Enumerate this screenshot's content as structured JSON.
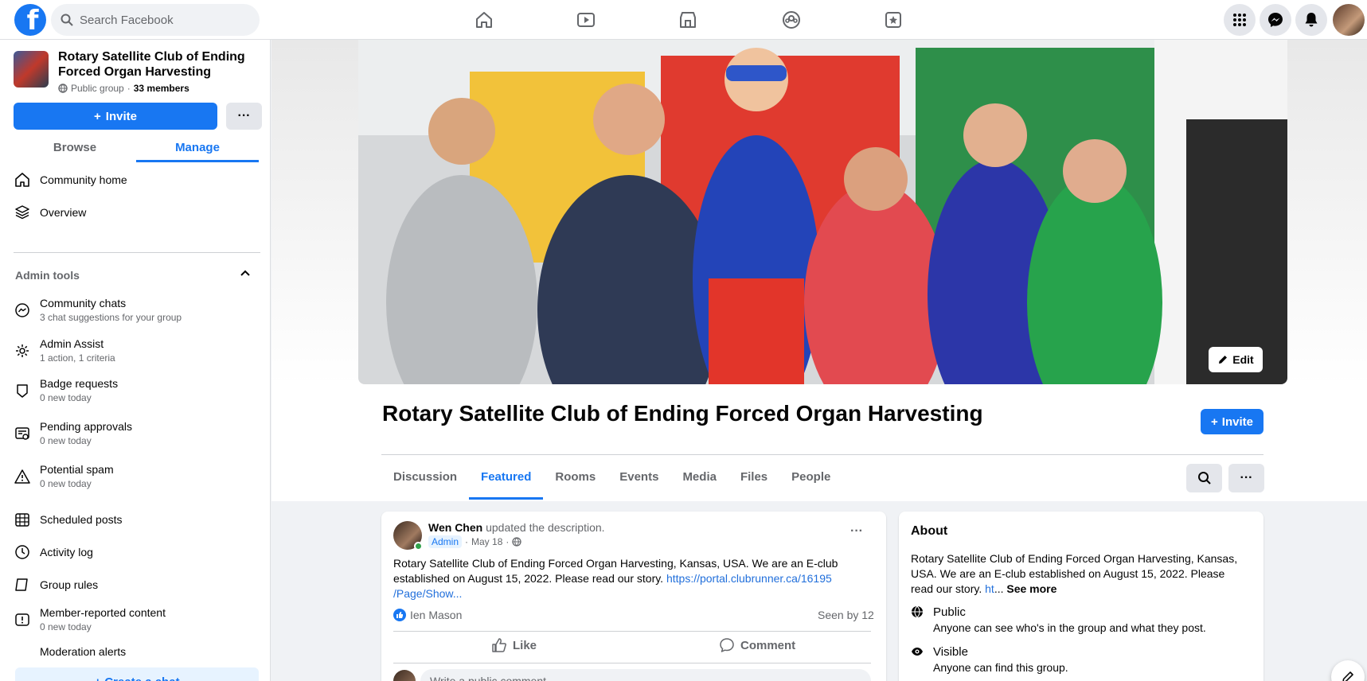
{
  "search": {
    "placeholder": "Search Facebook"
  },
  "nav": {
    "icons": [
      "home-icon",
      "watch-icon",
      "marketplace-icon",
      "groups-icon",
      "gaming-icon"
    ]
  },
  "header_right": {
    "icons": [
      "menu-grid-icon",
      "messenger-icon",
      "notifications-icon",
      "account-avatar"
    ]
  },
  "group": {
    "name": "Rotary Satellite Club of Ending Forced Organ Harvesting",
    "privacy": "Public group",
    "members": "33 members",
    "invite_label": "Invite",
    "more_label": "···"
  },
  "sidebar": {
    "tabs": [
      "Browse",
      "Manage"
    ],
    "active_tab": "Manage",
    "top_items": [
      {
        "label": "Community home",
        "icon": "home-icon"
      },
      {
        "label": "Overview",
        "icon": "layers-icon"
      }
    ],
    "admin_heading": "Admin tools",
    "admin_items": [
      {
        "label": "Community chats",
        "sub": "3 chat suggestions for your group",
        "icon": "chat-icon"
      },
      {
        "label": "Admin Assist",
        "sub": "1 action, 1 criteria",
        "icon": "gear-icon"
      },
      {
        "label": "Badge requests",
        "sub": "0 new today",
        "icon": "badge-icon"
      },
      {
        "label": "Pending approvals",
        "sub": "0 new today",
        "icon": "approvals-icon"
      },
      {
        "label": "Potential spam",
        "sub": "0 new today",
        "icon": "warning-icon"
      },
      {
        "label": "Scheduled posts",
        "sub": "",
        "icon": "calendar-icon"
      },
      {
        "label": "Activity log",
        "sub": "",
        "icon": "clock-icon"
      },
      {
        "label": "Group rules",
        "sub": "",
        "icon": "rules-icon"
      },
      {
        "label": "Member-reported content",
        "sub": "0 new today",
        "icon": "report-icon"
      },
      {
        "label": "Moderation alerts",
        "sub": "",
        "icon": "alert-icon"
      }
    ],
    "create_chat": "+ Create a chat"
  },
  "cover": {
    "edit_label": "Edit"
  },
  "main": {
    "title": "Rotary Satellite Club of Ending Forced Organ Harvesting",
    "invite_label": "Invite",
    "tabs": [
      "Discussion",
      "Featured",
      "Rooms",
      "Events",
      "Media",
      "Files",
      "People"
    ],
    "active_tab": "Featured"
  },
  "post": {
    "author": "Wen Chen",
    "action": "updated the description.",
    "badge": "Admin",
    "date": "May 18",
    "text": "Rotary Satellite Club of Ending Forced Organ Harvesting, Kansas, USA. We are an E-club established on August 15, 2022. Please read our story. ",
    "link": "https://portal.clubrunner.ca/16195 /Page/Show...",
    "liker": "Ien Mason",
    "seen": "Seen by 12",
    "like_label": "Like",
    "comment_label": "Comment",
    "comment_placeholder": "Write a public comment..."
  },
  "about": {
    "title": "About",
    "text": "Rotary Satellite Club of Ending Forced Organ Harvesting, Kansas, USA. We are an E-club established on August 15, 2022. Please read our story. ",
    "link": "ht",
    "ellipsis": "... ",
    "see_more": "See more",
    "public_title": "Public",
    "public_desc": "Anyone can see who's in the group and what they post.",
    "visible_title": "Visible",
    "visible_desc": "Anyone can find this group."
  },
  "colors": {
    "brand": "#1877f2",
    "background": "#f0f2f5",
    "text_secondary": "#65676b"
  }
}
